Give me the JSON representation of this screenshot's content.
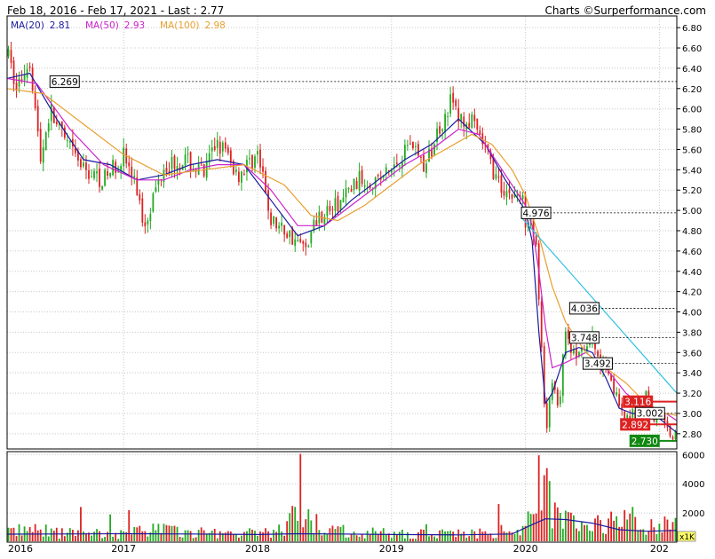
{
  "header": {
    "period_label": "Feb 18, 2016 - Feb 17, 2021 - Last : 2.77",
    "credit_label": "Charts",
    "credit_brand": "Surperformance.com"
  },
  "legend": [
    {
      "label": "MA(20)",
      "value": "2.81",
      "color": "#1a1aa0"
    },
    {
      "label": "MA(50)",
      "value": "2.93",
      "color": "#cc22cc"
    },
    {
      "label": "MA(100)",
      "value": "2.98",
      "color": "#e8a030"
    }
  ],
  "colors": {
    "up": "#22aa22",
    "down": "#dd2222",
    "grid": "#c8c8c8",
    "trendline": "#30c0e0",
    "level_line": "#000000",
    "red_level": "#dd2222",
    "last_badge": "#118811"
  },
  "chart_data": [
    {
      "type": "line",
      "title": "",
      "price_axis": {
        "ticks": [
          "2.80",
          "3.00",
          "3.20",
          "3.40",
          "3.60",
          "3.80",
          "4.00",
          "4.20",
          "4.40",
          "4.60",
          "4.80",
          "5.00",
          "5.20",
          "5.40",
          "5.60",
          "5.80",
          "6.00",
          "6.20",
          "6.40",
          "6.60",
          "6.80"
        ],
        "ylim": [
          2.65,
          6.88
        ]
      },
      "x_axis": {
        "labels": [
          "2016",
          "2017",
          "2018",
          "2019",
          "2020",
          "202"
        ],
        "label_times": [
          2016.13,
          2017.0,
          2018.0,
          2019.0,
          2020.0,
          2021.0
        ],
        "xlim": [
          2016.13,
          2021.13
        ]
      },
      "series": [
        {
          "key": "price",
          "x": [
            2016.13,
            2016.2,
            2016.3,
            2016.38,
            2016.45,
            2016.55,
            2016.7,
            2016.85,
            2017.0,
            2017.1,
            2017.15,
            2017.3,
            2017.45,
            2017.6,
            2017.7,
            2017.85,
            2018.0,
            2018.1,
            2018.25,
            2018.35,
            2018.45,
            2018.6,
            2018.75,
            2018.9,
            2019.0,
            2019.15,
            2019.25,
            2019.35,
            2019.45,
            2019.5,
            2019.6,
            2019.7,
            2019.8,
            2019.9,
            2019.97,
            2020.0,
            2020.04,
            2020.08,
            2020.12,
            2020.15,
            2020.2,
            2020.25,
            2020.3,
            2020.35,
            2020.4,
            2020.5,
            2020.55,
            2020.6,
            2020.65,
            2020.7,
            2020.75,
            2020.8,
            2020.85,
            2020.9,
            2020.95,
            2021.0,
            2021.05,
            2021.1,
            2021.13
          ],
          "y": [
            6.55,
            6.2,
            6.5,
            5.5,
            6.0,
            5.7,
            5.4,
            5.3,
            5.55,
            5.2,
            4.85,
            5.45,
            5.5,
            5.35,
            5.7,
            5.35,
            5.55,
            4.9,
            4.75,
            4.62,
            4.95,
            5.05,
            5.3,
            5.3,
            5.4,
            5.7,
            5.4,
            5.8,
            6.1,
            5.9,
            5.85,
            5.6,
            5.25,
            5.15,
            5.15,
            4.92,
            4.97,
            4.6,
            3.6,
            2.75,
            3.35,
            3.05,
            3.85,
            3.6,
            3.55,
            3.75,
            3.5,
            3.5,
            3.3,
            3.05,
            2.9,
            3.05,
            2.85,
            3.2,
            2.95,
            3.0,
            2.85,
            2.8,
            2.77
          ]
        },
        {
          "key": "MA(20)",
          "x": [
            2016.13,
            2016.3,
            2016.5,
            2016.7,
            2016.9,
            2017.1,
            2017.3,
            2017.5,
            2017.7,
            2017.9,
            2018.1,
            2018.3,
            2018.5,
            2018.7,
            2018.9,
            2019.1,
            2019.3,
            2019.5,
            2019.7,
            2019.85,
            2020.0,
            2020.05,
            2020.1,
            2020.15,
            2020.2,
            2020.3,
            2020.4,
            2020.5,
            2020.6,
            2020.7,
            2020.8,
            2020.9,
            2021.0,
            2021.13
          ],
          "y": [
            6.3,
            6.35,
            5.9,
            5.5,
            5.45,
            5.3,
            5.35,
            5.45,
            5.5,
            5.45,
            5.1,
            4.75,
            4.85,
            5.1,
            5.3,
            5.5,
            5.65,
            5.9,
            5.65,
            5.3,
            5.0,
            4.7,
            3.8,
            3.1,
            3.2,
            3.6,
            3.65,
            3.6,
            3.35,
            3.05,
            3.0,
            3.0,
            2.95,
            2.81
          ]
        },
        {
          "key": "MA(50)",
          "x": [
            2016.13,
            2016.35,
            2016.6,
            2016.85,
            2017.1,
            2017.3,
            2017.5,
            2017.7,
            2017.9,
            2018.1,
            2018.3,
            2018.5,
            2018.7,
            2018.9,
            2019.1,
            2019.3,
            2019.5,
            2019.65,
            2019.8,
            2020.0,
            2020.05,
            2020.1,
            2020.15,
            2020.2,
            2020.3,
            2020.45,
            2020.6,
            2020.75,
            2020.9,
            2021.05,
            2021.13
          ],
          "y": [
            6.3,
            6.25,
            5.8,
            5.45,
            5.3,
            5.3,
            5.4,
            5.45,
            5.45,
            5.2,
            4.85,
            4.85,
            5.05,
            5.25,
            5.45,
            5.6,
            5.8,
            5.75,
            5.45,
            5.05,
            4.85,
            4.4,
            3.85,
            3.45,
            3.5,
            3.6,
            3.45,
            3.2,
            3.05,
            3.0,
            2.93
          ]
        },
        {
          "key": "MA(100)",
          "x": [
            2016.13,
            2016.4,
            2016.7,
            2017.0,
            2017.3,
            2017.6,
            2017.9,
            2018.2,
            2018.4,
            2018.6,
            2018.8,
            2019.0,
            2019.2,
            2019.4,
            2019.6,
            2019.75,
            2019.9,
            2020.0,
            2020.1,
            2020.2,
            2020.3,
            2020.45,
            2020.6,
            2020.75,
            2020.9,
            2021.05,
            2021.13
          ],
          "y": [
            6.2,
            6.15,
            5.85,
            5.55,
            5.35,
            5.4,
            5.45,
            5.25,
            4.95,
            4.9,
            5.05,
            5.25,
            5.45,
            5.6,
            5.75,
            5.65,
            5.4,
            5.15,
            4.75,
            4.25,
            3.9,
            3.6,
            3.45,
            3.3,
            3.1,
            3.0,
            2.98
          ]
        }
      ],
      "trendline": {
        "x": [
          2019.97,
          2021.13
        ],
        "y": [
          4.93,
          3.2
        ]
      },
      "levels": [
        {
          "label": "6.269",
          "value": 6.269,
          "from": 2016.45,
          "style": "dashed-black"
        },
        {
          "label": "4.976",
          "value": 4.976,
          "from": 2019.97,
          "style": "dashed-black"
        },
        {
          "label": "4.036",
          "value": 4.036,
          "from": 2020.33,
          "style": "dashed-black"
        },
        {
          "label": "3.748",
          "value": 3.748,
          "from": 2020.33,
          "style": "dashed-black"
        },
        {
          "label": "3.492",
          "value": 3.492,
          "from": 2020.43,
          "style": "dashed-black"
        },
        {
          "label": "3.116",
          "value": 3.116,
          "from": 2020.73,
          "style": "solid-red"
        },
        {
          "label": "3.002",
          "value": 3.002,
          "from": 2020.82,
          "style": "dashed-black"
        },
        {
          "label": "2.892",
          "value": 2.892,
          "from": 2020.71,
          "style": "solid-red"
        },
        {
          "label": "2.730",
          "value": 2.73,
          "from": 2020.78,
          "style": "solid-green"
        }
      ]
    },
    {
      "type": "bar",
      "title": "",
      "volume_axis": {
        "ticks": [
          "2000",
          "4000",
          "6000"
        ],
        "ylim": [
          0,
          6200
        ],
        "unit_label": "x1K"
      },
      "volume_profile": {
        "x": [
          2016.13,
          2016.3,
          2016.5,
          2016.7,
          2016.9,
          2017.1,
          2017.2,
          2017.4,
          2017.6,
          2017.8,
          2018.0,
          2018.2,
          2018.3,
          2018.5,
          2018.7,
          2018.9,
          2019.1,
          2019.3,
          2019.5,
          2019.7,
          2019.85,
          2019.95,
          2020.05,
          2020.1,
          2020.15,
          2020.2,
          2020.3,
          2020.4,
          2020.5,
          2020.6,
          2020.7,
          2020.8,
          2020.9,
          2021.0,
          2021.13
        ],
        "y": [
          800,
          900,
          700,
          650,
          600,
          700,
          1200,
          700,
          650,
          700,
          600,
          900,
          2100,
          1000,
          700,
          650,
          600,
          600,
          700,
          600,
          800,
          900,
          1600,
          2400,
          3800,
          2600,
          1800,
          1500,
          1300,
          1200,
          1400,
          1500,
          1300,
          1200,
          1100
        ]
      },
      "volume_ma": {
        "x": [
          2016.13,
          2016.5,
          2017.0,
          2017.5,
          2018.0,
          2018.3,
          2018.6,
          2019.0,
          2019.5,
          2019.9,
          2020.05,
          2020.15,
          2020.3,
          2020.5,
          2020.7,
          2020.9,
          2021.13
        ],
        "y": [
          550,
          560,
          580,
          560,
          520,
          580,
          560,
          520,
          500,
          560,
          1200,
          1600,
          1550,
          1300,
          850,
          750,
          800
        ]
      }
    }
  ]
}
